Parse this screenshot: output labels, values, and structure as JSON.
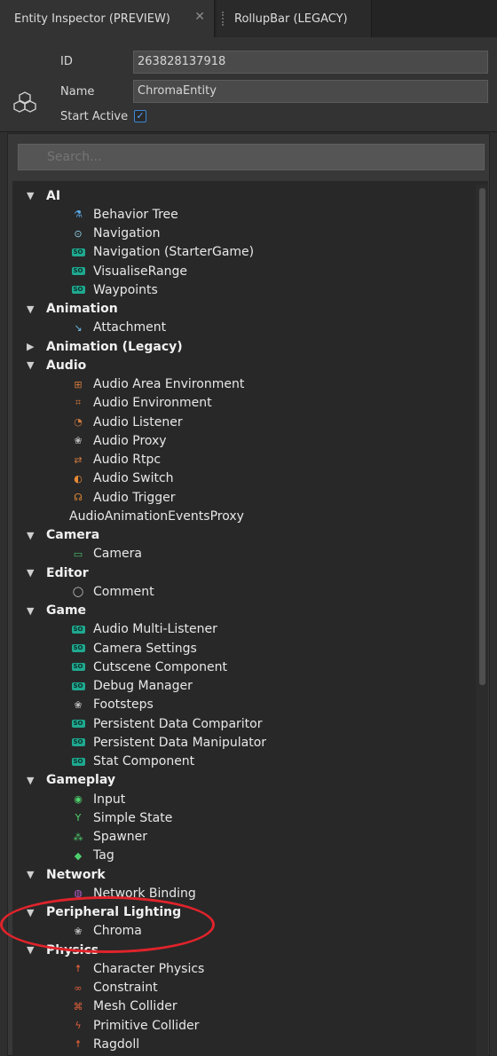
{
  "tabs": [
    {
      "label": "Entity Inspector (PREVIEW)",
      "close": "✕"
    },
    {
      "label": "RollupBar (LEGACY)"
    }
  ],
  "entity": {
    "id_label": "ID",
    "id_value": "263828137918",
    "name_label": "Name",
    "name_value": "ChromaEntity",
    "start_active_label": "Start Active",
    "start_active_checked": true
  },
  "search": {
    "placeholder": "Search..."
  },
  "colors": {
    "accent": "#3a86d6",
    "badge": "#1fa98f",
    "annotation": "#e0232b"
  },
  "categories": [
    {
      "name": "AI",
      "expanded": true,
      "items": [
        {
          "label": "Behavior Tree",
          "icon": "tree-icon"
        },
        {
          "label": "Navigation",
          "icon": "navigation-icon"
        },
        {
          "label": "Navigation (StarterGame)",
          "icon": "script-badge-icon"
        },
        {
          "label": "VisualiseRange",
          "icon": "script-badge-icon"
        },
        {
          "label": "Waypoints",
          "icon": "script-badge-icon"
        }
      ]
    },
    {
      "name": "Animation",
      "expanded": true,
      "items": [
        {
          "label": "Attachment",
          "icon": "attachment-icon"
        }
      ]
    },
    {
      "name": "Animation (Legacy)",
      "expanded": false,
      "items": []
    },
    {
      "name": "Audio",
      "expanded": true,
      "items": [
        {
          "label": "Audio Area Environment",
          "icon": "audio-area-icon"
        },
        {
          "label": "Audio Environment",
          "icon": "audio-environment-icon"
        },
        {
          "label": "Audio Listener",
          "icon": "audio-listener-icon"
        },
        {
          "label": "Audio Proxy",
          "icon": "proxy-icon"
        },
        {
          "label": "Audio Rtpc",
          "icon": "rtpc-icon"
        },
        {
          "label": "Audio Switch",
          "icon": "switch-icon"
        },
        {
          "label": "Audio Trigger",
          "icon": "headphones-icon"
        },
        {
          "label": "AudioAnimationEventsProxy",
          "icon": ""
        }
      ]
    },
    {
      "name": "Camera",
      "expanded": true,
      "items": [
        {
          "label": "Camera",
          "icon": "camera-icon"
        }
      ]
    },
    {
      "name": "Editor",
      "expanded": true,
      "items": [
        {
          "label": "Comment",
          "icon": "comment-icon"
        }
      ]
    },
    {
      "name": "Game",
      "expanded": true,
      "items": [
        {
          "label": "Audio Multi-Listener",
          "icon": "script-badge-icon"
        },
        {
          "label": "Camera Settings",
          "icon": "script-badge-icon"
        },
        {
          "label": "Cutscene Component",
          "icon": "script-badge-icon"
        },
        {
          "label": "Debug Manager",
          "icon": "script-badge-icon"
        },
        {
          "label": "Footsteps",
          "icon": "component-icon"
        },
        {
          "label": "Persistent Data Comparitor",
          "icon": "script-badge-icon"
        },
        {
          "label": "Persistent Data Manipulator",
          "icon": "script-badge-icon"
        },
        {
          "label": "Stat Component",
          "icon": "script-badge-icon"
        }
      ]
    },
    {
      "name": "Gameplay",
      "expanded": true,
      "items": [
        {
          "label": "Input",
          "icon": "input-icon"
        },
        {
          "label": "Simple State",
          "icon": "state-icon"
        },
        {
          "label": "Spawner",
          "icon": "spawner-icon"
        },
        {
          "label": "Tag",
          "icon": "tag-icon"
        }
      ]
    },
    {
      "name": "Network",
      "expanded": true,
      "items": [
        {
          "label": "Network Binding",
          "icon": "network-icon"
        }
      ]
    },
    {
      "name": "Peripheral Lighting",
      "expanded": true,
      "items": [
        {
          "label": "Chroma",
          "icon": "component-icon"
        }
      ]
    },
    {
      "name": "Physics",
      "expanded": true,
      "items": [
        {
          "label": "Character Physics",
          "icon": "character-physics-icon"
        },
        {
          "label": "Constraint",
          "icon": "constraint-icon"
        },
        {
          "label": "Mesh Collider",
          "icon": "mesh-collider-icon"
        },
        {
          "label": "Primitive Collider",
          "icon": "primitive-collider-icon"
        },
        {
          "label": "Ragdoll",
          "icon": "ragdoll-icon"
        }
      ]
    }
  ]
}
